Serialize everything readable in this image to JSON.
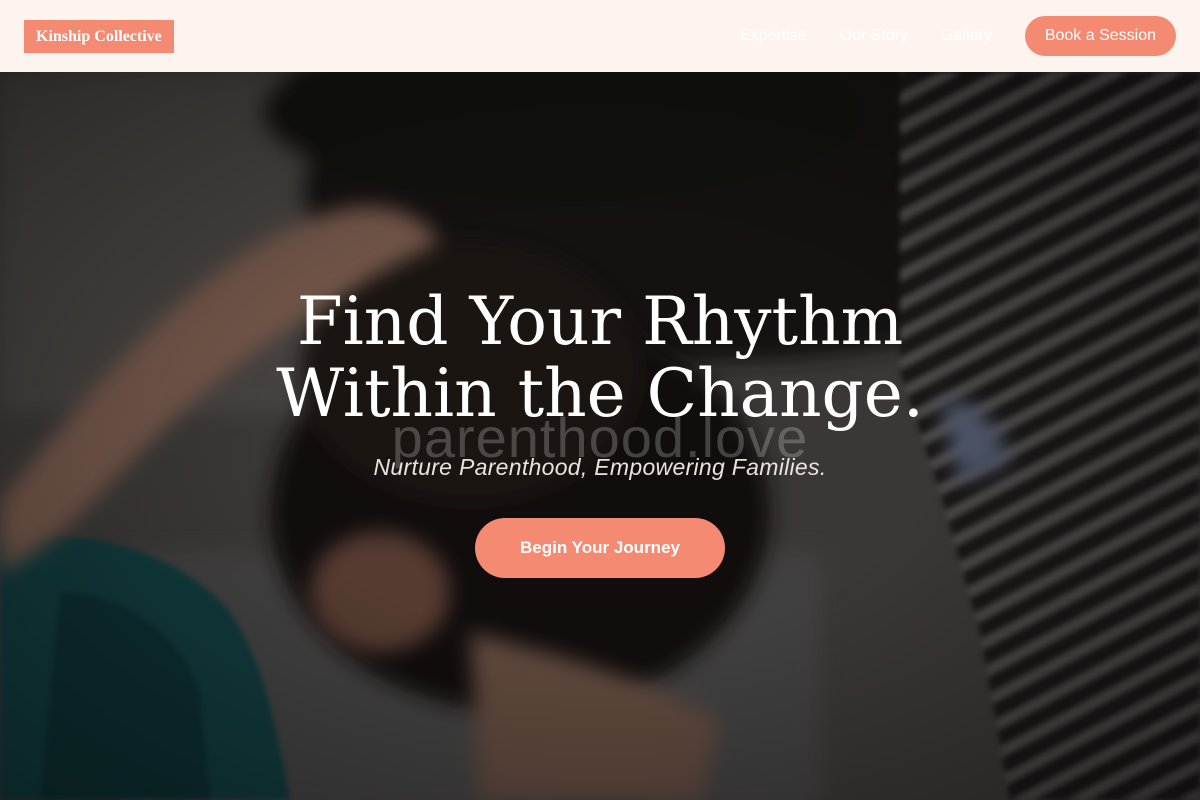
{
  "header": {
    "logo": "Kinship Collective",
    "nav": [
      "Expertise",
      "Our Story",
      "Gallery"
    ],
    "book_label": "Book a Session"
  },
  "hero": {
    "headline_line1": "Find Your Rhythm",
    "headline_line2": "Within the Change.",
    "watermark": "parenthood.love",
    "subline": "Nurture Parenthood, Empowering Families.",
    "cta_label": "Begin Your Journey"
  },
  "colors": {
    "accent": "#f48a72",
    "header_bg": "#fdf4ef",
    "text_light": "#ffffff"
  }
}
